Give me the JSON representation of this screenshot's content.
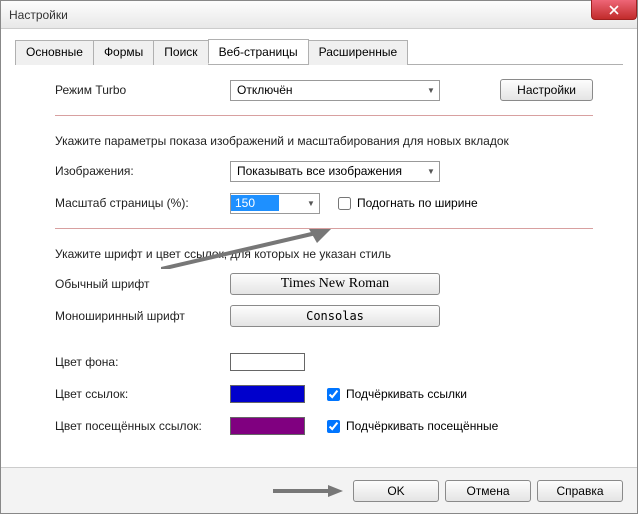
{
  "window": {
    "title": "Настройки"
  },
  "tabs": [
    "Основные",
    "Формы",
    "Поиск",
    "Веб-страницы",
    "Расширенные"
  ],
  "active_tab": 3,
  "turbo": {
    "label": "Режим Turbo",
    "value": "Отключён",
    "settings_btn": "Настройки"
  },
  "images_section": {
    "intro": "Укажите параметры показа изображений и масштабирования для новых вкладок",
    "images_label": "Изображения:",
    "images_value": "Показывать все изображения",
    "scale_label": "Масштаб страницы (%):",
    "scale_value": "150",
    "fit_width": "Подогнать по ширине"
  },
  "fonts_section": {
    "intro": "Укажите шрифт и цвет ссылок, для которых не указан стиль",
    "normal_label": "Обычный шрифт",
    "normal_value": "Times New Roman",
    "mono_label": "Моноширинный шрифт",
    "mono_value": "Consolas"
  },
  "colors": {
    "bg_label": "Цвет фона:",
    "bg_value": "#ffffff",
    "link_label": "Цвет ссылок:",
    "link_value": "#0000cc",
    "underline_links": "Подчёркивать ссылки",
    "visited_label": "Цвет посещённых ссылок:",
    "visited_value": "#800080",
    "underline_visited": "Подчёркивать посещённые"
  },
  "footer": {
    "ok": "OK",
    "cancel": "Отмена",
    "help": "Справка"
  }
}
